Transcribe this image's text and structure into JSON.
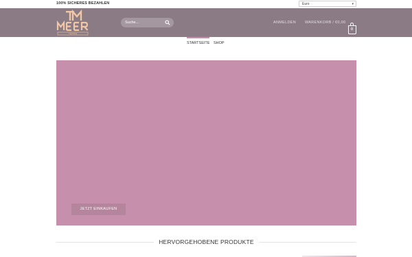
{
  "topbar": {
    "secure_label": "100% SICHERES BEZAHLEN",
    "currency_selected": "Euro"
  },
  "header": {
    "logo_alt": "TM MEER TEXTILE",
    "search_placeholder": "Suche...",
    "login_label": "ANMELDEN",
    "cart_label": "WARENKORB / €0,00",
    "cart_count": "0"
  },
  "nav": {
    "items": [
      "STARTSEITE",
      "SHOP"
    ],
    "active": "STARTSEITE"
  },
  "hero": {
    "cta_label": "JETZT EINKAUFEN"
  },
  "featured": {
    "title": "HERVORGEHOBENE PRODUKTE"
  },
  "colors": {
    "header_bg": "#8a7b84",
    "accent": "#c68fab",
    "logo_peach": "#f2c7a5"
  },
  "icons": [
    "search-icon",
    "cart-icon",
    "chevron-down-icon"
  ]
}
